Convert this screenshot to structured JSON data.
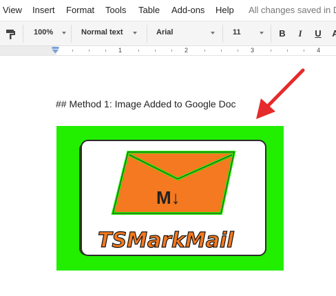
{
  "menu": {
    "items": [
      "View",
      "Insert",
      "Format",
      "Tools",
      "Table",
      "Add-ons",
      "Help"
    ],
    "save_status": "All changes saved in Drive"
  },
  "toolbar": {
    "paint_format_icon": "paint-roller-icon",
    "zoom": "100%",
    "style": "Normal text",
    "font": "Arial",
    "size": "11",
    "bold": "B",
    "italic": "I",
    "underline": "U",
    "text_color": "A"
  },
  "ruler": {
    "numbers": [
      "1",
      "2",
      "3",
      "4"
    ]
  },
  "document": {
    "heading": "## Method 1: Image Added to Google Doc",
    "image": {
      "wordmark": "TSMarkMail",
      "badge": "M↓",
      "background_color": "#22ee00",
      "envelope_color": "#f47920"
    }
  },
  "annotation": {
    "arrow_color": "#e52b2b"
  }
}
